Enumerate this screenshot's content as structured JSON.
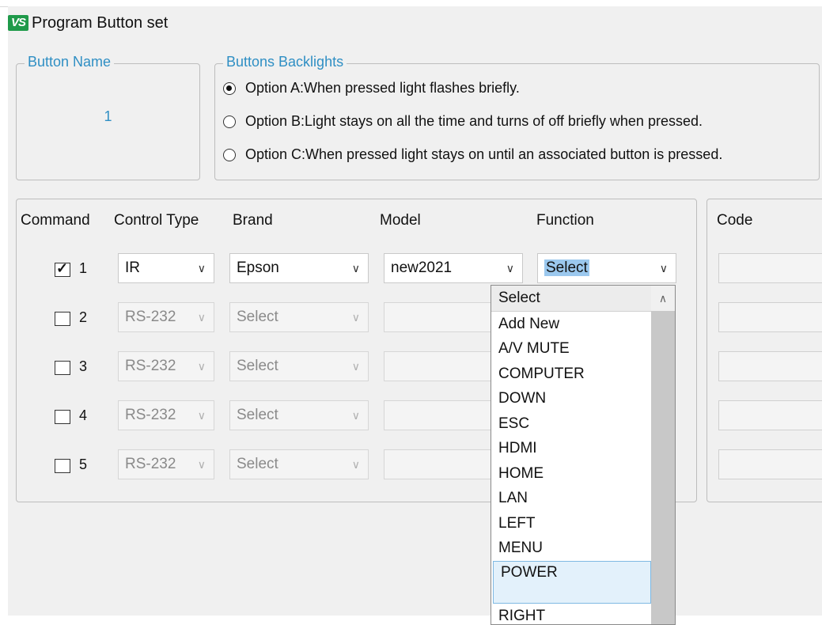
{
  "window": {
    "title": "Program Button set",
    "icon": "VS"
  },
  "button_name": {
    "legend": "Button  Name",
    "value": "1"
  },
  "backlights": {
    "legend": "Buttons Backlights",
    "options": [
      {
        "label": "Option A:When pressed light flashes briefly.",
        "selected": true
      },
      {
        "label": "Option B:Light stays on all the time and turns of off briefly when pressed.",
        "selected": false
      },
      {
        "label": "Option C:When pressed light stays on until an associated button is pressed.",
        "selected": false
      }
    ]
  },
  "table": {
    "headers": {
      "command": "Command",
      "control_type": "Control Type",
      "brand": "Brand",
      "model": "Model",
      "function": "Function",
      "code": "Code"
    },
    "rows": [
      {
        "num": "1",
        "checked": true,
        "control_type": "IR",
        "brand": "Epson",
        "model": "new2021",
        "function": "Select"
      },
      {
        "num": "2",
        "checked": false,
        "control_type": "RS-232",
        "brand": "Select",
        "model": "",
        "function": ""
      },
      {
        "num": "3",
        "checked": false,
        "control_type": "RS-232",
        "brand": "Select",
        "model": "",
        "function": ""
      },
      {
        "num": "4",
        "checked": false,
        "control_type": "RS-232",
        "brand": "Select",
        "model": "",
        "function": ""
      },
      {
        "num": "5",
        "checked": false,
        "control_type": "RS-232",
        "brand": "Select",
        "model": "",
        "function": ""
      }
    ]
  },
  "function_dropdown": {
    "items": [
      "Select",
      "Add New",
      "A/V MUTE",
      "COMPUTER",
      "DOWN",
      "ESC",
      "HDMI",
      "HOME",
      "LAN",
      "LEFT",
      "MENU",
      "POWER",
      "RIGHT"
    ],
    "hovered": "POWER"
  }
}
